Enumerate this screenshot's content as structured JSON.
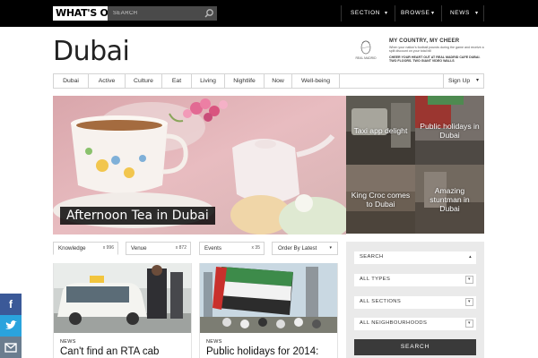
{
  "brand": {
    "logo": "WHAT'S ON"
  },
  "search": {
    "placeholder": "SEARCH"
  },
  "topnav": [
    {
      "label": "SECTION"
    },
    {
      "label": "BROWSE"
    },
    {
      "label": "NEWS"
    }
  ],
  "page": {
    "title": "Dubai"
  },
  "promo": {
    "crest_text": "REAL MADRID",
    "title": "MY COUNTRY, MY CHEER",
    "subtitle": "When your nation's football pounds during the game and receive a split discount on your total bill",
    "cta": "CHEER YOUR HEART OUT AT REAL MADRID CAFE DUBAI. TWO FLOORS. TWO GIANT VIDEO WALLS"
  },
  "catnav": {
    "items": [
      "Dubai",
      "Active",
      "Culture",
      "Eat",
      "Living",
      "Nightlife",
      "Now",
      "Well-being"
    ],
    "signup": "Sign Up"
  },
  "hero": {
    "caption": "Afternoon Tea in Dubai"
  },
  "tiles": [
    {
      "title": "Taxi app delight"
    },
    {
      "title": "Public holidays in Dubai"
    },
    {
      "title": "King Croc comes to Dubai"
    },
    {
      "title": "Amazing stuntman in Dubai"
    }
  ],
  "filters": [
    {
      "label": "Knowledge",
      "count": "x 996"
    },
    {
      "label": "Venue",
      "count": "x 872"
    },
    {
      "label": "Events",
      "count": "x 35"
    }
  ],
  "order": {
    "label": "Order By Latest"
  },
  "articles": [
    {
      "tag": "NEWS",
      "headline": "Can't find an RTA cab"
    },
    {
      "tag": "NEWS",
      "headline": "Public holidays for 2014:"
    }
  ],
  "sidebar": {
    "search_label": "SEARCH",
    "fields": [
      {
        "label": "ALL TYPES"
      },
      {
        "label": "ALL SECTIONS"
      },
      {
        "label": "ALL NEIGHBOURHOODS"
      }
    ],
    "button": "SEARCH"
  },
  "social": [
    {
      "icon": "f",
      "color": "#3b5998"
    },
    {
      "icon": "t",
      "color": "#2aa3dd"
    },
    {
      "icon": "✉",
      "color": "#6b7d8f"
    }
  ]
}
